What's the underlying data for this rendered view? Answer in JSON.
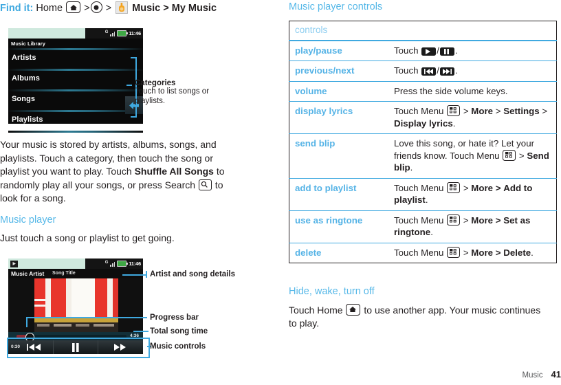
{
  "findit": {
    "lead": "Find it:",
    "home_label": "Home",
    "sep": ">",
    "app_label": "Music > My Music",
    "icons": [
      "home-icon",
      "dot-key-icon",
      "music-app-icon"
    ]
  },
  "screenshot_library": {
    "status": {
      "carrier": "G",
      "time": "11:46",
      "battery": "battery-icon",
      "signal": "signal-icon"
    },
    "title": "Music Library",
    "rows": [
      "Artists",
      "Albums",
      "Songs",
      "Playlists"
    ],
    "back_icon": "back-arrow-icon"
  },
  "callout_categories": {
    "title": "Categories",
    "desc_line1": "Touch to list songs or",
    "desc_line2": "playlists."
  },
  "paragraph": {
    "p1a": "Your music is stored by artists, albums, songs, and playlists. Touch a category, then touch the song or playlist you want to play. Touch ",
    "p1b": "Shuffle All Songs",
    "p1c": " to randomly play all your songs, or press Search ",
    "p1d": " to look for a song."
  },
  "section_music_player": {
    "heading": "Music player",
    "body": "Just touch a song or playlist to get going."
  },
  "screenshot_player": {
    "status": {
      "carrier": "G",
      "time": "11:46"
    },
    "artist": "Music Artist",
    "song": "Song Title",
    "current_time": "0:30",
    "total_time": "4:36"
  },
  "callouts_player": [
    {
      "label": "Artist and song details"
    },
    {
      "label": "Progress bar"
    },
    {
      "label": "Total song time"
    },
    {
      "label": "Music controls"
    }
  ],
  "right": {
    "heading": "Music player controls",
    "table": {
      "header": "controls",
      "rows": [
        {
          "key": "play/pause",
          "value_pre": "Touch ",
          "value_icons": [
            "play-icon",
            "pause-icon"
          ],
          "value_post": "."
        },
        {
          "key": "previous/next",
          "value_pre": "Touch ",
          "value_icons": [
            "previous-icon",
            "next-icon"
          ],
          "value_post": "."
        },
        {
          "key": "volume",
          "value_plain": "Press the side volume keys."
        },
        {
          "key": "display lyrics",
          "value_pre": "Touch Menu ",
          "menu_icon": "menu-icon",
          "value_parts": [
            " > ",
            "More",
            " > ",
            "Settings",
            " > ",
            "Display lyrics",
            "."
          ]
        },
        {
          "key": "send blip",
          "value_lead": "Love this song, or hate it? Let your friends know.",
          "value_pre": "Touch Menu ",
          "menu_icon": "menu-icon",
          "value_parts": [
            " > ",
            "Send blip",
            "."
          ]
        },
        {
          "key": "add to playlist",
          "value_pre": "Touch Menu ",
          "menu_icon": "menu-icon",
          "value_parts": [
            " > ",
            "More >",
            " ",
            "Add to playlist",
            "."
          ]
        },
        {
          "key": "use as ringtone",
          "value_pre": "Touch Menu ",
          "menu_icon": "menu-icon",
          "value_parts": [
            " > ",
            "More >",
            " ",
            "Set as ringtone",
            "."
          ]
        },
        {
          "key": "delete",
          "value_pre": "Touch Menu ",
          "menu_icon": "menu-icon",
          "value_parts": [
            " > ",
            "More >",
            " ",
            "Delete",
            "."
          ]
        }
      ]
    },
    "section_hide": {
      "heading": "Hide, wake, turn off",
      "body_pre": "Touch Home ",
      "home_icon": "home-icon",
      "body_post": " to use another app. Your music continues to play."
    }
  },
  "footer": {
    "chapter": "Music",
    "page": "41"
  },
  "colors": {
    "accent": "#3fa9e0",
    "heading": "#56b8e8",
    "key": "#55b3e6",
    "text": "#231f20"
  }
}
